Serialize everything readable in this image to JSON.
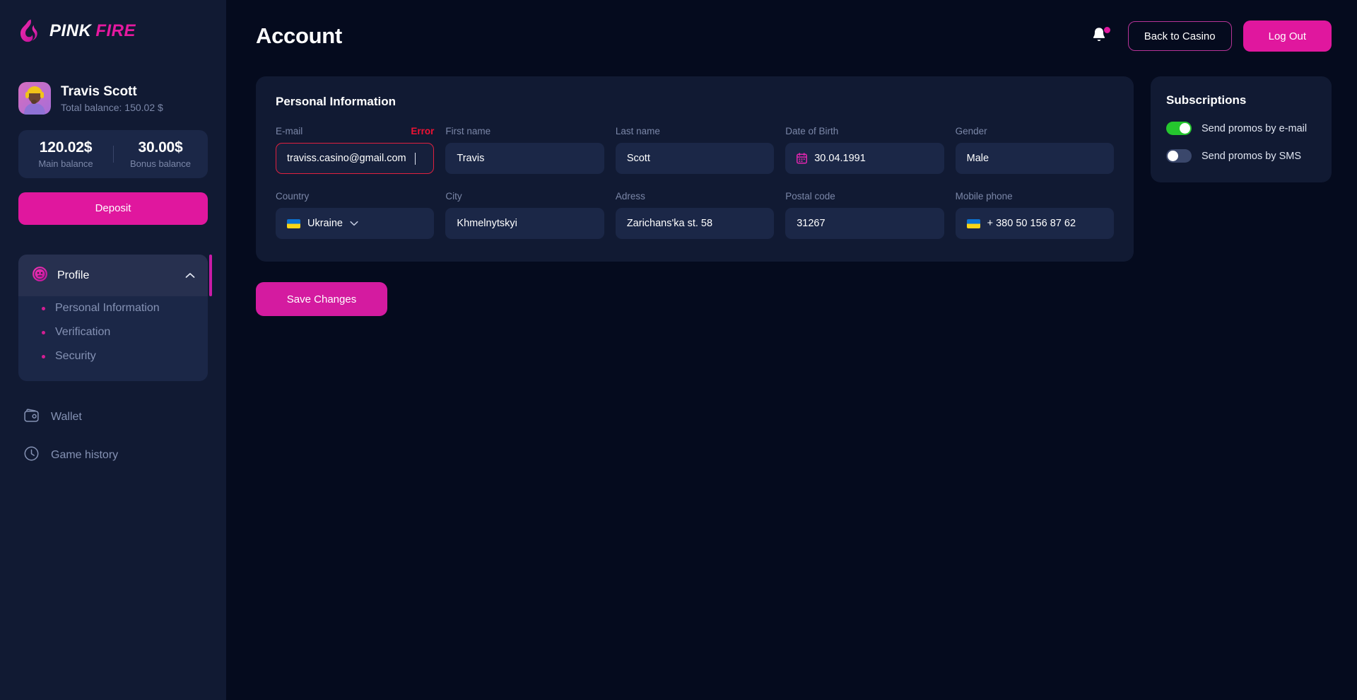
{
  "brand": {
    "name_1": "PINK",
    "name_2": "FIRE",
    "logo_icon": "flame-icon",
    "accent": "#e0179e"
  },
  "sidebar": {
    "user": {
      "name": "Travis Scott",
      "total_balance": "Total balance: 150.02 $",
      "avatar_icon": "user-avatar"
    },
    "balances": [
      {
        "amount": "120.02$",
        "label": "Main balance"
      },
      {
        "amount": "30.00$",
        "label": "Bonus balance"
      }
    ],
    "deposit_label": "Deposit",
    "profile_group": {
      "label": "Profile",
      "icon": "profile-face-icon",
      "chevron": "chevron-up-icon",
      "expanded": true,
      "items": [
        {
          "label": "Personal Information",
          "active": true
        },
        {
          "label": "Verification",
          "active": false
        },
        {
          "label": "Security",
          "active": false
        }
      ]
    },
    "nav_items": [
      {
        "label": "Wallet",
        "icon": "wallet-icon"
      },
      {
        "label": "Game history",
        "icon": "clock-icon"
      }
    ]
  },
  "header": {
    "title": "Account",
    "bell_icon": "bell-icon",
    "has_notification": true,
    "back_to_casino_label": "Back to Casino",
    "log_out_label": "Log Out"
  },
  "personal_information": {
    "title": "Personal Information",
    "row1": [
      {
        "label": "E-mail",
        "value": "traviss.casino@gmail.com",
        "error": "Error",
        "has_error": true,
        "focused": true
      },
      {
        "label": "First name",
        "value": "Travis"
      },
      {
        "label": "Last name",
        "value": "Scott"
      },
      {
        "label": "Date of Birth",
        "value": "30.04.1991",
        "icon": "calendar-icon"
      },
      {
        "label": "Gender",
        "value": "Male"
      }
    ],
    "row2": [
      {
        "label": "Country",
        "value": "Ukraine",
        "flag": "ukraine-flag",
        "type": "select",
        "chevron": "chevron-down-icon"
      },
      {
        "label": "City",
        "value": "Khmelnytskyi"
      },
      {
        "label": "Adress",
        "value": "Zarichans'ka st. 58"
      },
      {
        "label": "Postal code",
        "value": "31267"
      },
      {
        "label": "Mobile phone",
        "value": "+ 380 50 156 87 62",
        "flag": "ukraine-flag"
      }
    ],
    "save_label": "Save Changes"
  },
  "subscriptions": {
    "title": "Subscriptions",
    "items": [
      {
        "label": "Send promos by e-mail",
        "on": true
      },
      {
        "label": "Send promos by SMS",
        "on": false
      }
    ]
  }
}
